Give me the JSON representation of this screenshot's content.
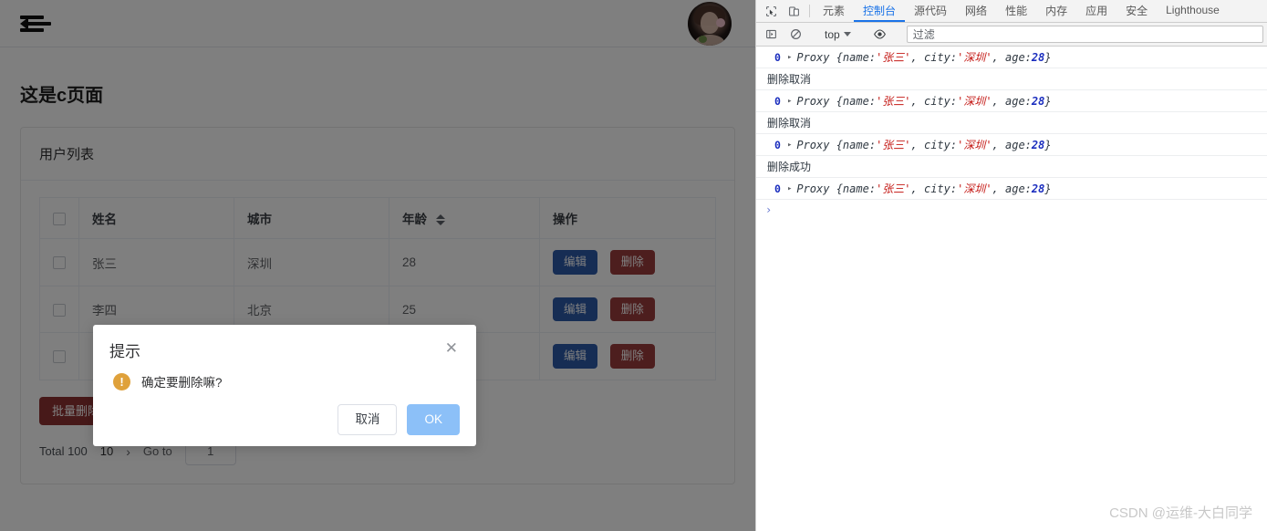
{
  "app": {
    "header": {
      "menu_icon": "menu-fold-icon",
      "avatar": "user-avatar"
    },
    "page_title": "这是c页面",
    "card": {
      "title": "用户列表",
      "table": {
        "columns": [
          "",
          "姓名",
          "城市",
          "年龄",
          "操作"
        ],
        "sortable_column": "年龄",
        "rows": [
          {
            "name": "张三",
            "city": "深圳",
            "age": "28",
            "edit": "编辑",
            "delete": "删除"
          },
          {
            "name": "李四",
            "city": "北京",
            "age": "25",
            "edit": "编辑",
            "delete": "删除"
          },
          {
            "name": "",
            "city": "",
            "age": "",
            "edit": "编辑",
            "delete": "删除"
          }
        ]
      },
      "batch_delete_label": "批量删除",
      "pagination": {
        "total": "Total 100",
        "page_size": "10",
        "next_arrow": "›",
        "goto_label": "Go to",
        "goto_value": "1"
      }
    },
    "modal": {
      "title": "提示",
      "close": "✕",
      "warn_icon": "!",
      "message": "确定要删除嘛?",
      "cancel_label": "取消",
      "ok_label": "OK"
    }
  },
  "devtools": {
    "tabs": [
      {
        "label": "元素",
        "active": false
      },
      {
        "label": "控制台",
        "active": true
      },
      {
        "label": "源代码",
        "active": false
      },
      {
        "label": "网络",
        "active": false
      },
      {
        "label": "性能",
        "active": false
      },
      {
        "label": "内存",
        "active": false
      },
      {
        "label": "应用",
        "active": false
      },
      {
        "label": "安全",
        "active": false
      },
      {
        "label": "Lighthouse",
        "active": false
      }
    ],
    "toolbar": {
      "sidebar_icon": "console-sidebar-icon",
      "clear_icon": "clear-console-icon",
      "context": "top",
      "eye_icon": "live-expression-icon",
      "filter_placeholder": "过滤"
    },
    "console_logs": [
      {
        "type": "object",
        "count": "0",
        "expand": "▸",
        "prefix": "Proxy {name: ",
        "name": "'张三'",
        "mid": ", city: ",
        "city": "'深圳'",
        "suffix": ", age: ",
        "age": "28",
        "close": "}"
      },
      {
        "type": "text",
        "text": "删除取消"
      },
      {
        "type": "object",
        "count": "0",
        "expand": "▸",
        "prefix": "Proxy {name: ",
        "name": "'张三'",
        "mid": ", city: ",
        "city": "'深圳'",
        "suffix": ", age: ",
        "age": "28",
        "close": "}"
      },
      {
        "type": "text",
        "text": "删除取消"
      },
      {
        "type": "object",
        "count": "0",
        "expand": "▸",
        "prefix": "Proxy {name: ",
        "name": "'张三'",
        "mid": ", city: ",
        "city": "'深圳'",
        "suffix": ", age: ",
        "age": "28",
        "close": "}"
      },
      {
        "type": "text",
        "text": "删除成功"
      },
      {
        "type": "object",
        "count": "0",
        "expand": "▸",
        "prefix": "Proxy {name: ",
        "name": "'张三'",
        "mid": ", city: ",
        "city": "'深圳'",
        "suffix": ", age: ",
        "age": "28",
        "close": "}"
      }
    ],
    "prompt": "›"
  },
  "watermark": "CSDN @运维-大白同学",
  "colors": {
    "accent": "#1a73e8",
    "edit_button": "#2d5aa8",
    "delete_button": "#9b3d3d",
    "batch_delete": "#8f3232",
    "ok_button": "#8cc0f8",
    "warn_icon": "#dfa13b",
    "log_string": "#c41a16",
    "log_number": "#1a2dbe"
  }
}
